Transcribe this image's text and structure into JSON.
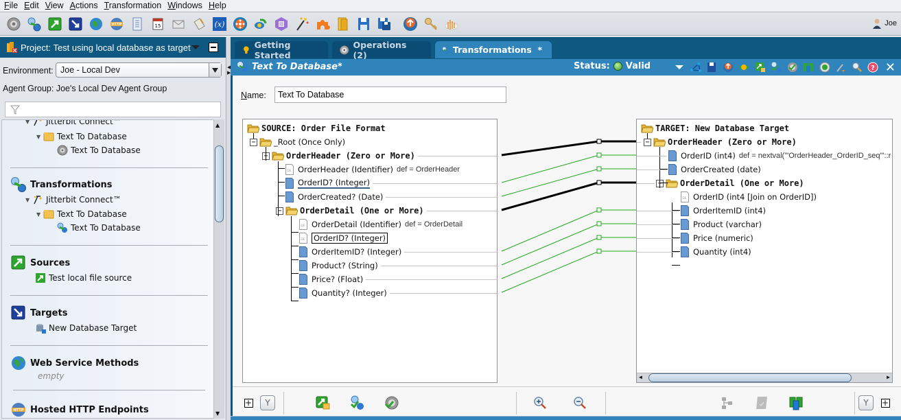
{
  "menubar": {
    "items": [
      "File",
      "Edit",
      "View",
      "Actions",
      "Transformation",
      "Windows",
      "Help"
    ]
  },
  "toolbar": {
    "icons": [
      "operation-icon",
      "transformation-icon",
      "source-icon",
      "target-icon",
      "web-service-icon",
      "http-endpoint-icon",
      "document-icon",
      "schedule-icon",
      "email-icon",
      "script-icon",
      "global-variable-icon",
      "connector-icon",
      "deploy-icon",
      "list-icon",
      "magic-wand-icon",
      "plugin-icon",
      "folder-icon",
      "save-icon",
      "save-all-icon",
      "deploy-upload-icon",
      "key-icon",
      "cloud-icon"
    ],
    "user": "Joe"
  },
  "project": {
    "title": "Project: Test using local database as target",
    "environment_label": "Environment:",
    "environment_value": "Joe - Local Dev",
    "agent_group": "Agent Group: Joe's Local Dev Agent Group",
    "filter_value": ""
  },
  "tree": {
    "operations_partial": {
      "connect": "Jitterbit Connect™",
      "folder": "Text To Database",
      "item": "Text To Database"
    },
    "transformations": {
      "title": "Transformations",
      "connect": "Jitterbit Connect™",
      "folder": "Text To Database",
      "item": "Text To Database"
    },
    "sources": {
      "title": "Sources",
      "item": "Test local file source"
    },
    "targets": {
      "title": "Targets",
      "item": "New Database Target"
    },
    "web_service_methods": {
      "title": "Web Service Methods",
      "empty": "empty"
    },
    "hosted_http": {
      "title": "Hosted HTTP Endpoints"
    }
  },
  "tabs": [
    {
      "label": "Getting Started",
      "active": false
    },
    {
      "label": "Operations (2)",
      "active": false
    },
    {
      "label": "Transformations  *",
      "active": true
    }
  ],
  "editor": {
    "title": "Text To Database*",
    "status_label": "Status:",
    "status_value": "Valid",
    "status_color": "#3d9a2a",
    "name_label": "Name:",
    "name_value": "Text To Database"
  },
  "source": {
    "title": "SOURCE: Order File Format",
    "nodes": [
      {
        "label": "_Root (Once Only)",
        "type": "folder",
        "bold": false
      },
      {
        "label": "OrderHeader (Zero or More)",
        "type": "folder",
        "bold": true
      },
      {
        "label": "OrderHeader (Identifier)",
        "type": "id",
        "def": "def = OrderHeader"
      },
      {
        "label": "OrderID? (Integer)",
        "type": "field"
      },
      {
        "label": "OrderCreated? (Date)",
        "type": "field"
      },
      {
        "label": "OrderDetail (One or More)",
        "type": "folder",
        "bold": true
      },
      {
        "label": "OrderDetail (Identifier)",
        "type": "id",
        "def": "def = OrderDetail"
      },
      {
        "label": "OrderID? (Integer)",
        "type": "id"
      },
      {
        "label": "OrderItemID? (Integer)",
        "type": "field"
      },
      {
        "label": "Product? (String)",
        "type": "field"
      },
      {
        "label": "Price? (Float)",
        "type": "field"
      },
      {
        "label": "Quantity? (Integer)",
        "type": "field"
      }
    ]
  },
  "target": {
    "title": "TARGET: New Database Target",
    "nodes": [
      {
        "label": "OrderHeader (Zero or More)",
        "type": "folder",
        "bold": true
      },
      {
        "label": "OrderID (int4)",
        "type": "field",
        "def": "def = nextval('\"OrderHeader_OrderID_seq\"'::r"
      },
      {
        "label": "OrderCreated (date)",
        "type": "field"
      },
      {
        "label": "OrderDetail (One or More)",
        "type": "folder",
        "bold": true
      },
      {
        "label": "OrderID (int4 [Join on OrderID])",
        "type": "id"
      },
      {
        "label": "OrderItemID (int4)",
        "type": "field"
      },
      {
        "label": "Product (varchar)",
        "type": "field"
      },
      {
        "label": "Price (numeric)",
        "type": "field"
      },
      {
        "label": "Quantity (int4)",
        "type": "field"
      }
    ]
  },
  "mappings": [
    {
      "from": "OrderHeader (Zero or More)",
      "to": "OrderHeader (Zero or More)",
      "kind": "loop"
    },
    {
      "from": "OrderID? (Integer)",
      "to": "OrderID (int4)",
      "kind": "field"
    },
    {
      "from": "OrderCreated? (Date)",
      "to": "OrderCreated (date)",
      "kind": "field"
    },
    {
      "from": "OrderDetail (One or More)",
      "to": "OrderDetail (One or More)",
      "kind": "loop"
    },
    {
      "from": "OrderItemID? (Integer)",
      "to": "OrderItemID (int4)",
      "kind": "field"
    },
    {
      "from": "Product? (String)",
      "to": "Product (varchar)",
      "kind": "field"
    },
    {
      "from": "Price? (Float)",
      "to": "Price (numeric)",
      "kind": "field"
    },
    {
      "from": "Quantity? (Integer)",
      "to": "Quantity (int4)",
      "kind": "field"
    }
  ],
  "colors": {
    "header_blue": "#0e5882",
    "tab_active": "#2f84bb",
    "map_field": "#1fa81f",
    "map_loop": "#000000"
  }
}
